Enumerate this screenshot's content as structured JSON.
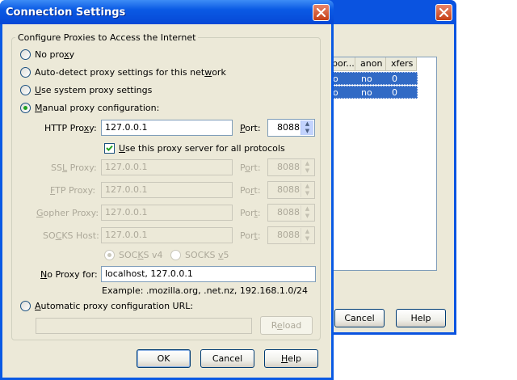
{
  "bg_window": {
    "columns": [
      "por...",
      "anon",
      "xfers"
    ],
    "rows": [
      {
        "port": "o",
        "anon": "no",
        "xfers": "0"
      },
      {
        "port": "o",
        "anon": "no",
        "xfers": "0"
      }
    ],
    "cancel_label": "Cancel",
    "help_label": "Help"
  },
  "dialog": {
    "title": "Connection Settings",
    "group_title": "Configure Proxies to Access the Internet",
    "options": {
      "no_proxy": {
        "pre": "No pro",
        "key": "x",
        "post": "y",
        "selected": false
      },
      "auto_detect": {
        "pre": "Auto-detect proxy settings for this net",
        "key": "w",
        "post": "ork",
        "selected": false
      },
      "system": {
        "pre": "",
        "key": "U",
        "post": "se system proxy settings",
        "selected": false
      },
      "manual": {
        "pre": "",
        "key": "M",
        "post": "anual proxy configuration:",
        "selected": true
      },
      "auto_url": {
        "pre": "",
        "key": "A",
        "post": "utomatic proxy configuration URL:",
        "selected": false
      }
    },
    "http": {
      "pre": "HTTP Pro",
      "key": "x",
      "post": "y:",
      "value": "127.0.0.1",
      "port_pre": "",
      "port_key": "P",
      "port_post": "ort:",
      "port": "8088"
    },
    "use_for_all": {
      "pre": "",
      "key": "U",
      "post": "se this proxy server for all protocols",
      "checked": true
    },
    "ssl": {
      "pre": "SS",
      "key": "L",
      "post": " Proxy:",
      "value": "127.0.0.1",
      "port_pre": "P",
      "port_key": "o",
      "port_post": "rt:",
      "port": "8088"
    },
    "ftp": {
      "pre": "",
      "key": "F",
      "post": "TP Proxy:",
      "value": "127.0.0.1",
      "port_pre": "Po",
      "port_key": "r",
      "port_post": "t:",
      "port": "8088"
    },
    "gopher": {
      "pre": "",
      "key": "G",
      "post": "opher Proxy:",
      "value": "127.0.0.1",
      "port_pre": "Por",
      "port_key": "t",
      "port_post": ":",
      "port": "8088"
    },
    "socks": {
      "pre": "SO",
      "key": "C",
      "post": "KS Host:",
      "value": "127.0.0.1",
      "port_pre": "Por",
      "port_key": "t",
      "port_post": ":",
      "port": "8088"
    },
    "socks_v4": {
      "pre": "SOC",
      "key": "K",
      "post": "S v4",
      "selected": true
    },
    "socks_v5": {
      "pre": "SOCKS ",
      "key": "v",
      "post": "5",
      "selected": false
    },
    "no_proxy_for": {
      "pre": "",
      "key": "N",
      "post": "o Proxy for:",
      "value": "localhost, 127.0.0.1"
    },
    "example": "Example: .mozilla.org, .net.nz, 192.168.1.0/24",
    "reload": {
      "pre": "R",
      "key": "e",
      "post": "load"
    },
    "ok_label": "OK",
    "cancel_label": "Cancel",
    "help": {
      "pre": "",
      "key": "H",
      "post": "elp"
    }
  }
}
